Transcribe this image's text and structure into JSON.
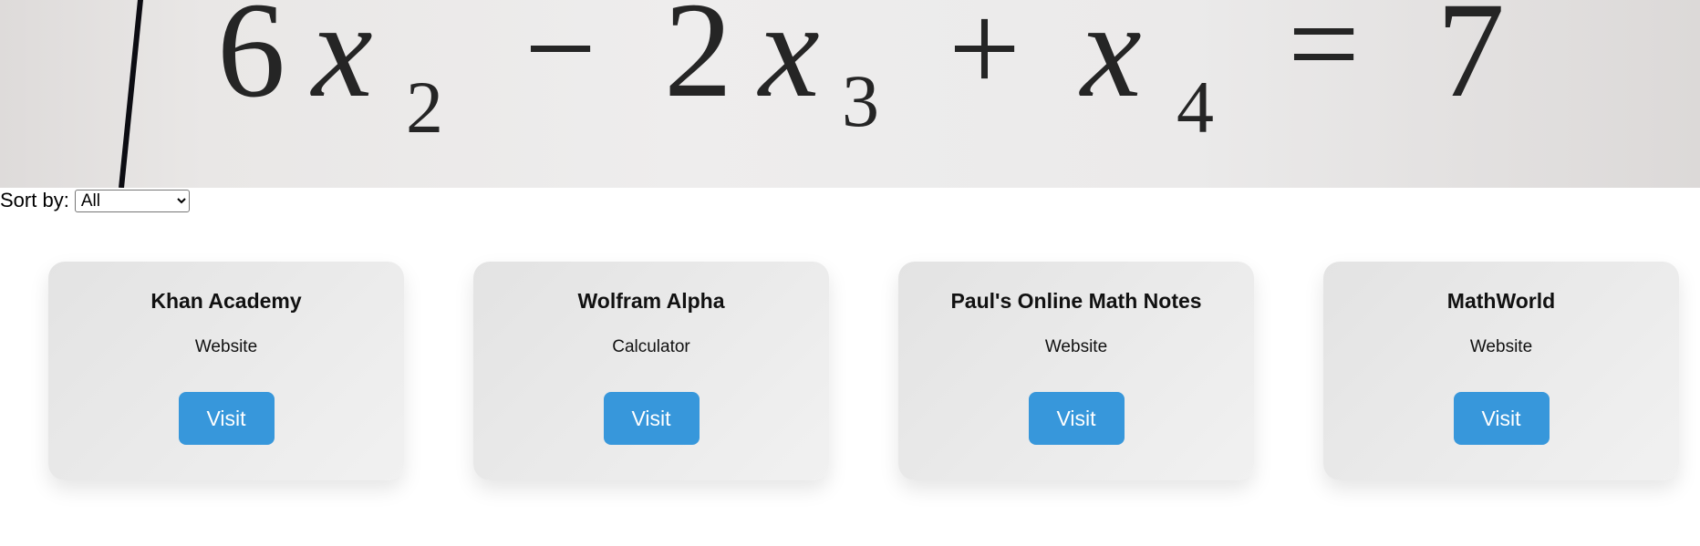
{
  "hero": {
    "equation": {
      "coef1": "6",
      "var1": "x",
      "sub1": "2",
      "op1": "−",
      "coef2": "2",
      "var2": "x",
      "sub2": "3",
      "op2": "+",
      "var3": "x",
      "sub3": "4",
      "eq": "=",
      "rhs": "7"
    }
  },
  "sort": {
    "label": "Sort by:",
    "selected": "All",
    "options": [
      "All"
    ]
  },
  "cards": [
    {
      "title": "Khan Academy",
      "type": "Website",
      "button": "Visit"
    },
    {
      "title": "Wolfram Alpha",
      "type": "Calculator",
      "button": "Visit"
    },
    {
      "title": "Paul's Online Math Notes",
      "type": "Website",
      "button": "Visit"
    },
    {
      "title": "MathWorld",
      "type": "Website",
      "button": "Visit"
    }
  ],
  "colors": {
    "button": "#3797db",
    "card_bg": "#e8e8e8"
  }
}
